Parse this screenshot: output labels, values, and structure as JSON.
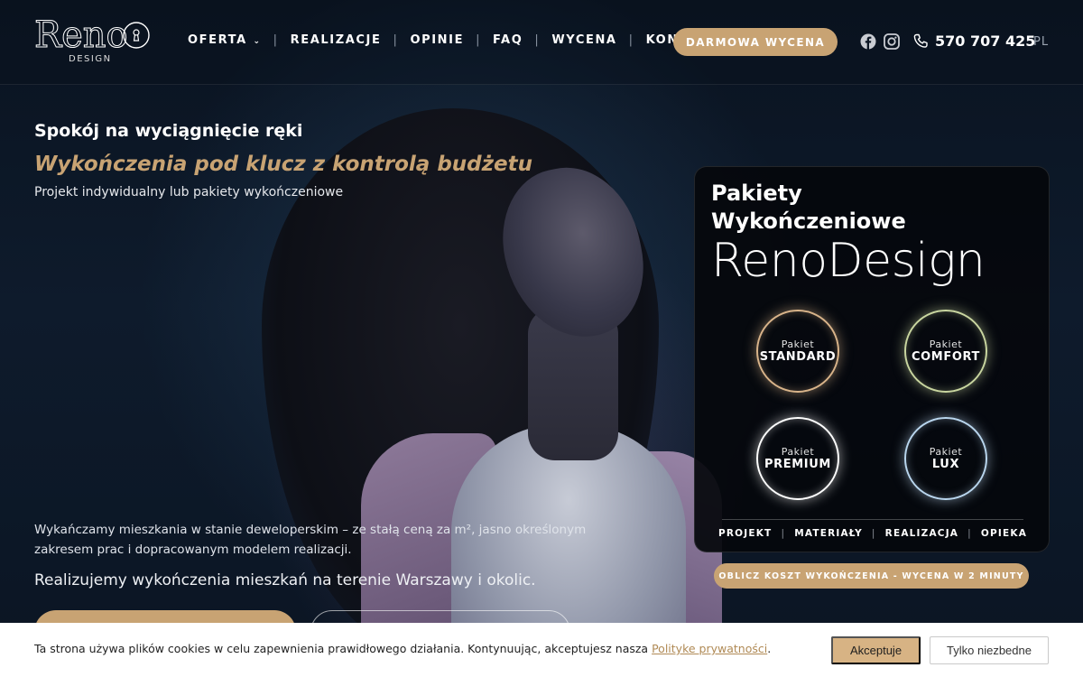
{
  "logo": {
    "word": "Reno",
    "sub": "DESIGN"
  },
  "nav": {
    "items": [
      "OFERTA",
      "REALIZACJE",
      "OPINIE",
      "FAQ",
      "WYCENA",
      "KONTAKT"
    ],
    "separator": "|",
    "cta": "DARMOWA WYCENA",
    "phone": "570 707 425",
    "lang": "PL"
  },
  "hero": {
    "title": "Spokój na wyciągnięcie ręki",
    "subtitle": "Wykończenia pod klucz z kontrolą budżetu",
    "desc": "Projekt indywidualny lub pakiety wykończeniowe",
    "p1": "Wykańczamy mieszkania w stanie deweloperskim – ze stałą ceną za m², jasno określonym zakresem prac i dopracowanym modelem realizacji.",
    "p2": "Realizujemy wykończenia mieszkań na terenie Warszawy i okolic."
  },
  "card": {
    "heading_line1": "Pakiety",
    "heading_line2": "Wykończeniowe",
    "brand": "RenoDesign",
    "packages": [
      {
        "small": "Pakiet",
        "name": "STANDARD",
        "color": "#d9b48a"
      },
      {
        "small": "Pakiet",
        "name": "COMFORT",
        "color": "#c9d6a0"
      },
      {
        "small": "Pakiet",
        "name": "PREMIUM",
        "color": "#ffffff"
      },
      {
        "small": "Pakiet",
        "name": "LUX",
        "color": "#b9d6ee"
      }
    ],
    "features": [
      "PROJEKT",
      "MATERIAŁY",
      "REALIZACJA",
      "OPIEKA"
    ],
    "cta": "OBLICZ KOSZT WYKOŃCZENIA - WYCENA W 2 MINUTY"
  },
  "cookie": {
    "text": "Ta strona używa plików cookies w celu zapewnienia prawidłowego działania. Kontynuując, akceptujesz nasza",
    "link": "Polityke prywatności",
    "after": ".",
    "accept": "Akceptuje",
    "only_necessary": "Tylko niezbedne"
  },
  "colors": {
    "accent": "#c8a373",
    "background": "#0c1624"
  },
  "icons": [
    "facebook-icon",
    "instagram-icon",
    "phone-icon",
    "chevron-down-icon",
    "keyhole-icon"
  ]
}
